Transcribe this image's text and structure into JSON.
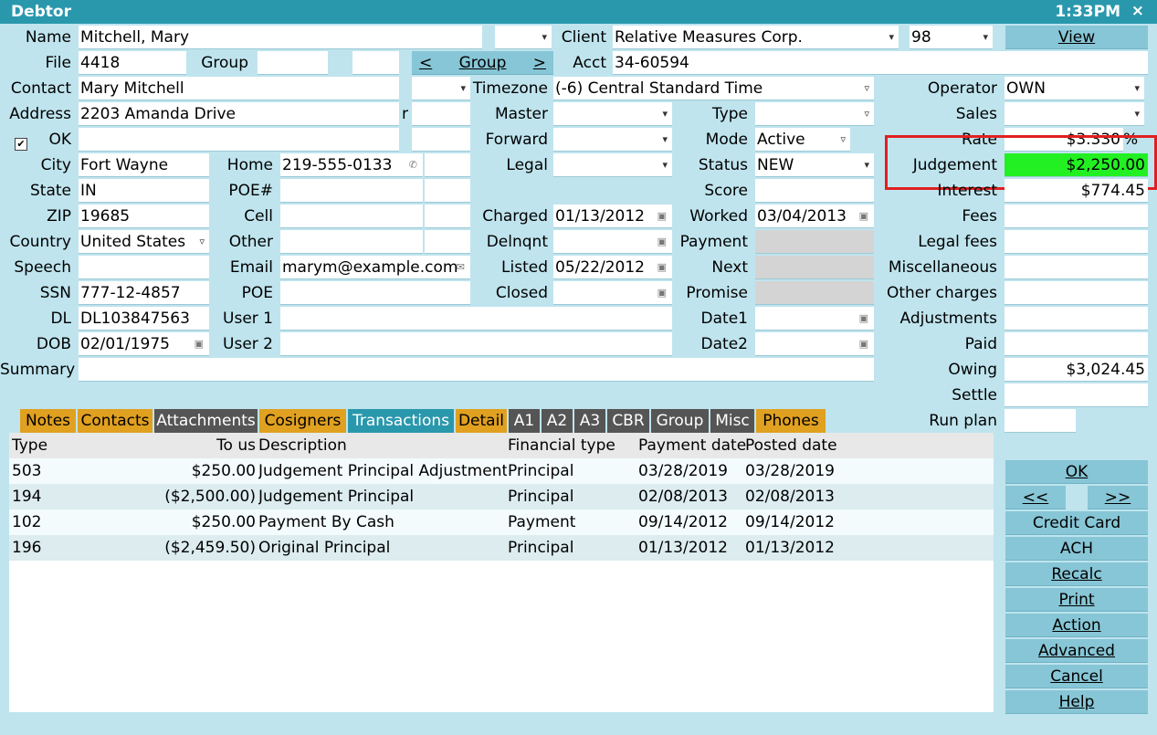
{
  "window": {
    "title": "Debtor",
    "clock": "1:33PM",
    "close": "×"
  },
  "left": {
    "name_label": "Name",
    "name_value": "Mitchell, Mary",
    "file_label": "File",
    "file_value": "4418",
    "group_label": "Group",
    "group_value": "",
    "contact_label": "Contact",
    "contact_value": "Mary Mitchell",
    "address_label": "Address",
    "address_value": "2203 Amanda Drive",
    "address_r": "r",
    "ok_label": "OK",
    "ok_checked": "✔",
    "city_label": "City",
    "city_value": "Fort Wayne",
    "state_label": "State",
    "state_value": "IN",
    "zip_label": "ZIP",
    "zip_value": "19685",
    "country_label": "Country",
    "country_value": "United States",
    "speech_label": "Speech",
    "ssn_label": "SSN",
    "ssn_value": "777-12-4857",
    "dl_label": "DL",
    "dl_value": "DL103847563",
    "dob_label": "DOB",
    "dob_value": "02/01/1975",
    "summary_label": "Summary"
  },
  "mid": {
    "home_label": "Home",
    "home_value": "219-555-0133",
    "poe_hash_label": "POE#",
    "cell_label": "Cell",
    "other_label": "Other",
    "email_label": "Email",
    "email_value": "marym@example.com",
    "poe_label": "POE",
    "user1_label": "User 1",
    "user2_label": "User 2",
    "group_btn_prev": "<",
    "group_btn_label": "Group",
    "group_btn_next": ">",
    "client_label": "Client",
    "client_value": "Relative Measures Corp.",
    "client_num": "98",
    "acct_label": "Acct",
    "acct_value": "34-60594",
    "timezone_label": "Timezone",
    "timezone_value": "(-6) Central Standard Time",
    "master_label": "Master",
    "forward_label": "Forward",
    "legal_label": "Legal",
    "charged_label": "Charged",
    "charged_value": "01/13/2012",
    "delnqnt_label": "Delnqnt",
    "listed_label": "Listed",
    "listed_value": "05/22/2012",
    "closed_label": "Closed",
    "type_label": "Type",
    "mode_label": "Mode",
    "mode_value": "Active",
    "status_label": "Status",
    "status_value": "NEW",
    "score_label": "Score",
    "worked_label": "Worked",
    "worked_value": "03/04/2013",
    "payment_label": "Payment",
    "next_label": "Next",
    "promise_label": "Promise",
    "date1_label": "Date1",
    "date2_label": "Date2",
    "view_btn": "View"
  },
  "right": {
    "operator_label": "Operator",
    "operator_value": "OWN",
    "sales_label": "Sales",
    "rate_label": "Rate",
    "rate_value": "$3.330",
    "rate_unit": "%",
    "judgement_label": "Judgement",
    "judgement_value": "$2,250.00",
    "interest_label": "Interest",
    "interest_value": "$774.45",
    "fees_label": "Fees",
    "legalfees_label": "Legal fees",
    "misc_label": "Miscellaneous",
    "othercharges_label": "Other charges",
    "adjustments_label": "Adjustments",
    "paid_label": "Paid",
    "owing_label": "Owing",
    "owing_value": "$3,024.45",
    "settle_label": "Settle",
    "runplan_label": "Run plan"
  },
  "tabs": [
    "Notes",
    "Contacts",
    "Attachments",
    "Cosigners",
    "Transactions",
    "Detail",
    "A1",
    "A2",
    "A3",
    "CBR",
    "Group",
    "Misc",
    "Phones"
  ],
  "grid": {
    "headers": [
      "Type",
      "To us",
      "Description",
      "Financial type",
      "Payment date",
      "Posted date"
    ],
    "rows": [
      [
        "503",
        "$250.00",
        "Judgement Principal Adjustment",
        "Principal",
        "03/28/2019",
        "03/28/2019"
      ],
      [
        "194",
        "($2,500.00)",
        "Judgement Principal",
        "Principal",
        "02/08/2013",
        "02/08/2013"
      ],
      [
        "102",
        "$250.00",
        "Payment By Cash",
        "Payment",
        "09/14/2012",
        "09/14/2012"
      ],
      [
        "196",
        "($2,459.50)",
        "Original Principal",
        "Principal",
        "01/13/2012",
        "01/13/2012"
      ]
    ]
  },
  "buttons": {
    "ok": "OK",
    "prev": "<<",
    "next": ">>",
    "credit_card": "Credit Card",
    "ach": "ACH",
    "recalc": "Recalc",
    "print": "Print",
    "action": "Action",
    "advanced": "Advanced",
    "cancel": "Cancel",
    "help": "Help"
  },
  "colors": {
    "accent": "#2a98ac",
    "highlight": "#22f022",
    "bg": "#bfe4ee"
  }
}
